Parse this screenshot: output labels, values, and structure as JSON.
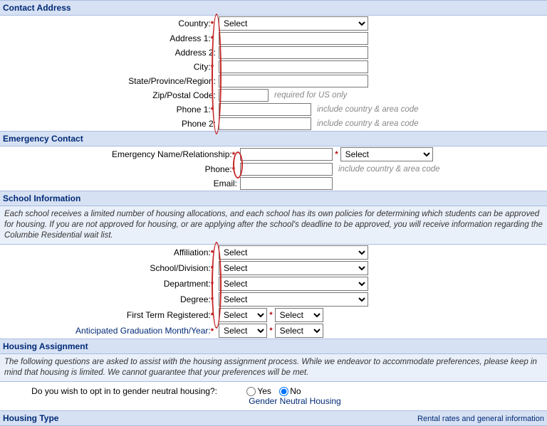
{
  "sections": {
    "contact": {
      "title": "Contact Address"
    },
    "emergency": {
      "title": "Emergency Contact"
    },
    "school": {
      "title": "School Information",
      "desc": "Each school receives a limited number of housing allocations, and each school has its own policies for determining which students can be approved for housing. If you are not approved for housing, or are applying after the school's deadline to be approved, you will receive information regarding the Columbie Residential wait list."
    },
    "housing_assign": {
      "title": "Housing Assignment",
      "desc": "The following questions are asked to assist with the housing assignment process. While we endeavor to accommodate preferences, please keep in mind that housing is limited. We cannot guarantee that your preferences will be met."
    },
    "housing_type": {
      "title": "Housing Type",
      "right_link": "Rental rates and general information"
    }
  },
  "contact": {
    "country_label": "Country:",
    "country_select": "Select",
    "address1_label": "Address 1:",
    "address2_label": "Address 2:",
    "city_label": "City:",
    "state_label": "State/Province/Region:",
    "zip_label": "Zip/Postal Code:",
    "zip_hint": "required for US only",
    "phone1_label": "Phone 1:",
    "phone2_label": "Phone 2:",
    "phone_hint": "include country & area code"
  },
  "emergency": {
    "name_label": "Emergency Name/Relationship:",
    "rel_select": "Select",
    "phone_label": "Phone:",
    "phone_hint": "include country & area code",
    "email_label": "Email:"
  },
  "school": {
    "affiliation_label": "Affiliation:",
    "division_label": "School/Division:",
    "department_label": "Department:",
    "degree_label": "Degree:",
    "first_term_label": "First Term Registered:",
    "grad_label": "Anticipated Graduation Month/Year:",
    "select_default": "Select"
  },
  "housing": {
    "gnh_question": "Do you wish to opt in to gender neutral housing?:",
    "yes": "Yes",
    "no": "No",
    "gnh_link": "Gender Neutral Housing",
    "gnh_value": "No"
  },
  "req_marker": "*"
}
